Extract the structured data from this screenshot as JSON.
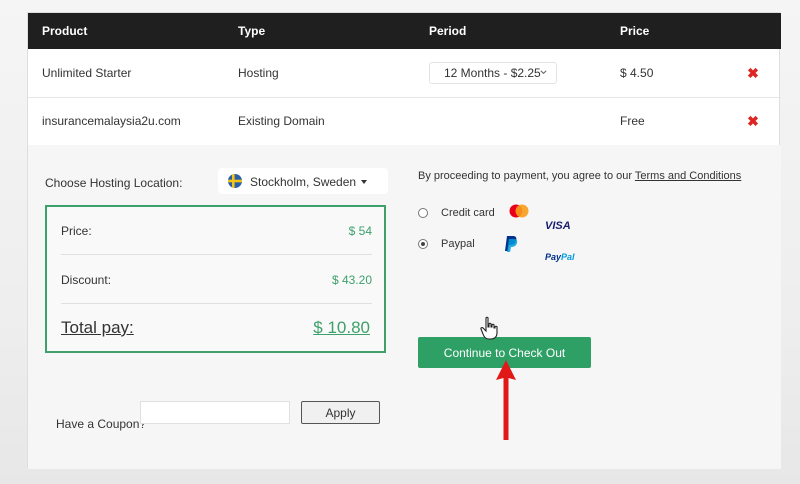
{
  "table": {
    "headers": {
      "product": "Product",
      "type": "Type",
      "period": "Period",
      "price": "Price"
    },
    "rows": [
      {
        "product": "Unlimited Starter",
        "type": "Hosting",
        "period": "12 Months - $2.25",
        "price": "$ 4.50"
      },
      {
        "product": "insurancemalaysia2u.com",
        "type": "Existing Domain",
        "period": "",
        "price": "Free"
      }
    ]
  },
  "hosting_location": {
    "label": "Choose Hosting Location:",
    "value": "Stockholm, Sweden"
  },
  "summary": {
    "price_label": "Price:",
    "price_value": "$ 54",
    "discount_label": "Discount:",
    "discount_value": "$ 43.20",
    "total_label": "Total pay:",
    "total_value": "$ 10.80"
  },
  "coupon": {
    "label": "Have a Coupon?",
    "placeholder": "",
    "button": "Apply"
  },
  "agreement": {
    "text": "By proceeding to payment, you agree to our",
    "link": "Terms and Conditions"
  },
  "payment": {
    "options": [
      {
        "label": "Credit card",
        "selected": false,
        "icons": [
          "mastercard-icon",
          "visa-icon"
        ]
      },
      {
        "label": "Paypal",
        "selected": true,
        "icons": [
          "paypal-icon"
        ]
      }
    ],
    "visa_text": "VISA",
    "paypal_text_1": "Pay",
    "paypal_text_2": "Pal"
  },
  "checkout": {
    "label": "Continue to Check Out"
  },
  "colors": {
    "accent": "#2fa065",
    "summary_border": "#3ea06b",
    "delete": "#e02424",
    "annotation_arrow": "#e01818",
    "header_bg": "#1f1f1f"
  }
}
